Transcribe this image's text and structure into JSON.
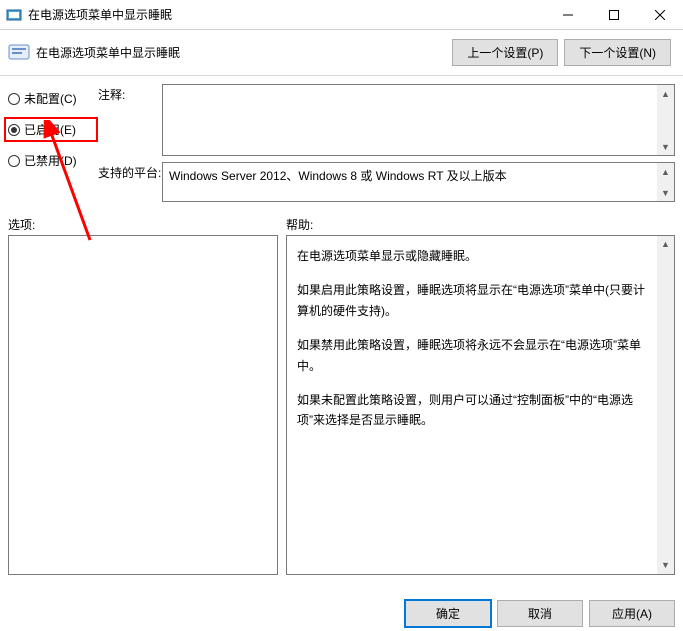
{
  "window": {
    "title": "在电源选项菜单中显示睡眠"
  },
  "subheader": {
    "title": "在电源选项菜单中显示睡眠",
    "prev_btn": "上一个设置(P)",
    "next_btn": "下一个设置(N)"
  },
  "radios": {
    "not_configured": "未配置(C)",
    "enabled": "已启用(E)",
    "disabled": "已禁用(D)"
  },
  "labels": {
    "comment": "注释:",
    "platform": "支持的平台:",
    "options": "选项:",
    "help": "帮助:"
  },
  "platform_text": "Windows Server 2012、Windows 8 或 Windows RT 及以上版本",
  "help_paragraphs": {
    "p0": "在电源选项菜单显示或隐藏睡眠。",
    "p1": "如果启用此策略设置，睡眠选项将显示在“电源选项”菜单中(只要计算机的硬件支持)。",
    "p2": "如果禁用此策略设置，睡眠选项将永远不会显示在“电源选项”菜单中。",
    "p3": "如果未配置此策略设置，则用户可以通过“控制面板”中的“电源选项”来选择是否显示睡眠。"
  },
  "buttons": {
    "ok": "确定",
    "cancel": "取消",
    "apply": "应用(A)"
  }
}
